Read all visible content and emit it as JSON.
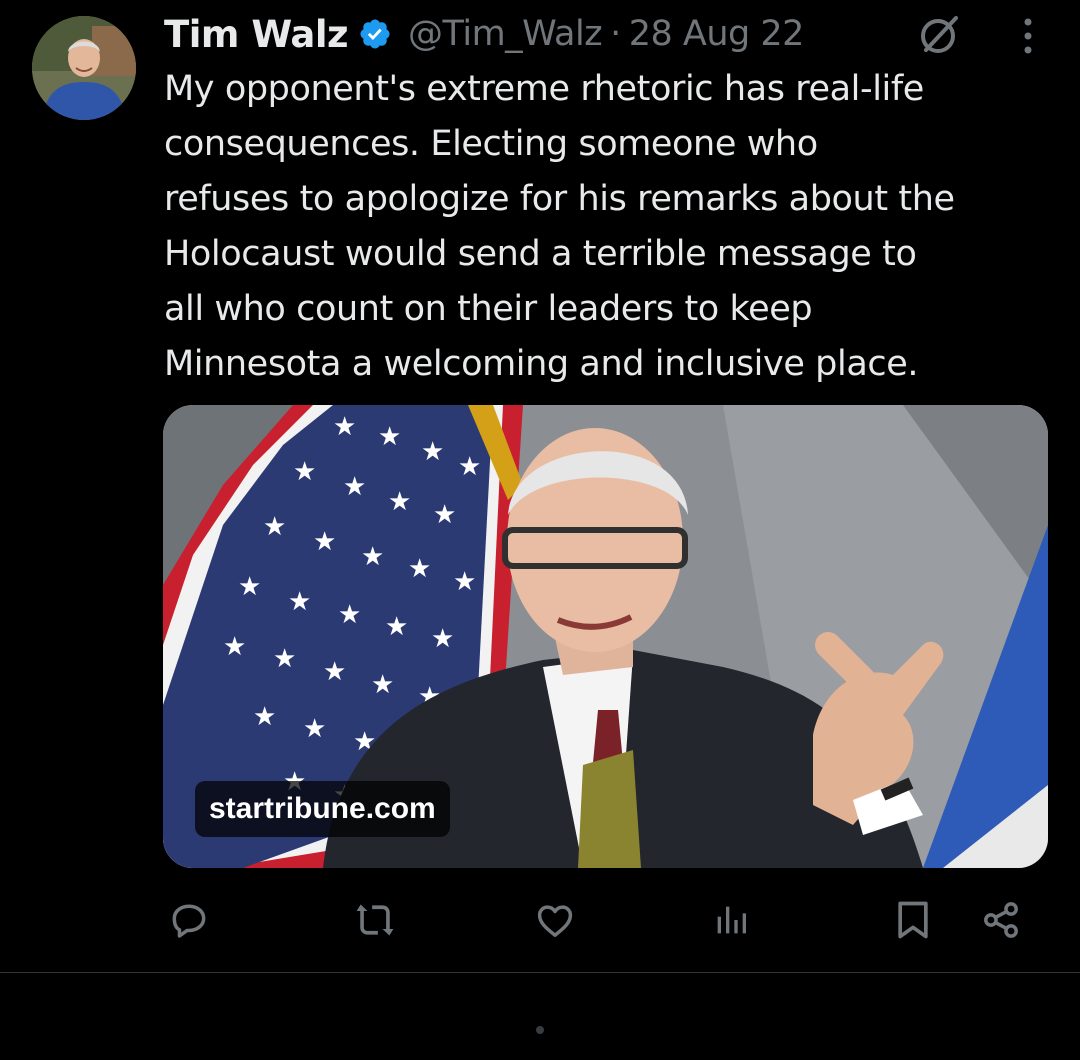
{
  "tweet": {
    "author_name": "Tim Walz",
    "handle": "@Tim_Walz",
    "separator": "·",
    "date": "28 Aug 22",
    "text": "My opponent's extreme rhetoric has real-life\nconsequences. Electing someone who\nrefuses to apologize for his remarks about the\nHolocaust would send a terrible message to\nall who count on their leaders to keep\nMinnesota a welcoming and inclusive place.",
    "card": {
      "domain": "startribune.com"
    }
  },
  "icons": {
    "verified": "verified-badge-icon",
    "grok": "grok-icon",
    "more": "more-options-icon",
    "reply": "reply-icon",
    "repost": "repost-icon",
    "like": "like-icon",
    "views": "views-icon",
    "bookmark": "bookmark-icon",
    "share": "share-icon"
  },
  "colors": {
    "background": "#000000",
    "text": "#e7e9ea",
    "secondary_text": "#71767b",
    "verified": "#1d9bf0"
  }
}
